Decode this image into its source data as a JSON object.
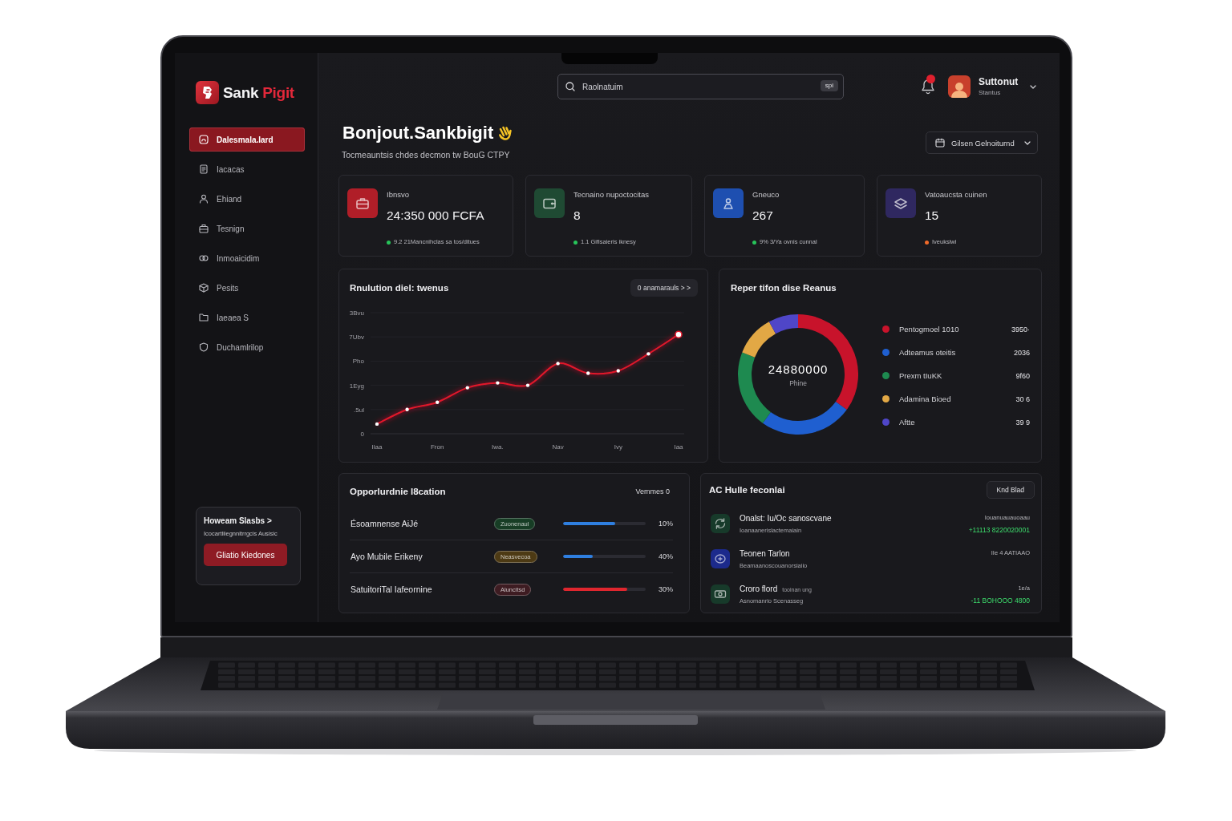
{
  "sidebar": {
    "logo": {
      "name": "Sank",
      "accent": "Pigit"
    },
    "nav": [
      {
        "label": "Dalesmala.Iard",
        "selected": true
      },
      {
        "label": "Iacacas",
        "selected": false
      },
      {
        "label": "Ehiand",
        "selected": false
      },
      {
        "label": "Tesnign",
        "selected": false
      },
      {
        "label": "Inmoaicidim",
        "selected": false
      },
      {
        "label": "Pesits",
        "selected": false
      },
      {
        "label": "Iaeaea S",
        "selected": false
      },
      {
        "label": "Duchamlrilop",
        "selected": false
      }
    ],
    "promo": {
      "title": "Howeam Slasbs >",
      "text": "Icocartliiegnnitrrgcis Ausisic",
      "button": "Gliatio Kiedones"
    }
  },
  "topbar": {
    "search": {
      "placeholder": "Raolnatuim",
      "shortcut": "spi"
    },
    "notifications": {
      "unread": true
    },
    "user": {
      "name": "Suttonut",
      "role": "Stantus"
    }
  },
  "header": {
    "title": "Bonjout.Sankbigit",
    "subtitle": "Tocmeauntsis chdes decmon tw BouG CTPY",
    "button": "Gilsen Gelnoiturnd"
  },
  "stats": [
    {
      "title": "Ibnsvo",
      "value": "24:350 000 FCFA",
      "color": "#b01e28",
      "trend": {
        "text": "9.2 21Mancnihclas sa tos/ditues",
        "color": "#27c45a"
      }
    },
    {
      "title": "Tecnaino nupoctocitas",
      "value": "8",
      "color": "#1f4a33",
      "trend": {
        "text": "1.1 Gifisaieris iknesy",
        "color": "#27c45a"
      }
    },
    {
      "title": "Gneuco",
      "value": "267",
      "color": "#1e4fb0",
      "trend": {
        "text": "9% 3/Ya ovnis cunnal",
        "color": "#27c45a"
      }
    },
    {
      "title": "Vatoaucsta cuinen",
      "value": "15",
      "color": "#2f2860",
      "trend": {
        "text": "Iveuksiwi",
        "color": "#f06a2a"
      }
    }
  ],
  "revenue_chart": {
    "title": "Rnulution diel: twenus",
    "period": "0 anamarauls > >",
    "y_axis_labels": [
      "3Bvu",
      "7Ubv",
      "Pho",
      "1Eyg",
      ".5ul",
      "0"
    ],
    "x_axis_labels": [
      "Ilaa",
      "Fron",
      "Iwa.",
      "Nav",
      "Ivy",
      "Iaa"
    ]
  },
  "breakdown": {
    "title": "Reper tifon dise Reanus",
    "total": "24880000",
    "total_label": "Phine",
    "legend": [
      {
        "label": "Pentogmoel 1010",
        "value": "3950·",
        "color": "#c8132b"
      },
      {
        "label": "Adteamus oteitis",
        "value": "2036",
        "color": "#1f5fd0"
      },
      {
        "label": "Prexm tIuKK",
        "value": "9f60",
        "color": "#1e8a50"
      },
      {
        "label": "Adamina Bioed",
        "value": "30 6",
        "color": "#e2a845"
      },
      {
        "label": "Aftte",
        "value": "39 9",
        "color": "#4f46c8"
      }
    ],
    "chart_data": {
      "type": "donut",
      "values": [
        35,
        25,
        21,
        11,
        8
      ]
    }
  },
  "opportunities": {
    "title": "Opporlurdnie l8cation",
    "filter": "Vemmes 0",
    "rows": [
      {
        "name": "Ésoamnense AiJé",
        "badge": {
          "text": "Zuonenaul",
          "color": "#173d25"
        },
        "progress": {
          "level": 0.63,
          "color": "#2f7fe0"
        },
        "percent": "10%"
      },
      {
        "name": "Ayo Mubile Erikeny",
        "badge": {
          "text": "Neasvecoa",
          "color": "#4d3a14"
        },
        "progress": {
          "level": 0.36,
          "color": "#2f7fe0"
        },
        "percent": "40%"
      },
      {
        "name": "SatuitoriTal Iafeornine",
        "badge": {
          "text": "Aluncitsd",
          "color": "#3e1c22"
        },
        "progress": {
          "level": 0.78,
          "color": "#e0262e"
        },
        "percent": "30%"
      }
    ]
  },
  "activity": {
    "title": "AC Hulle feconlai",
    "button": "Knd Blad",
    "rows": [
      {
        "title": "Onalst: Iu/Oc sanoscvane",
        "subtitle": "Ioanaanerislactemaiain",
        "date": "Iouanuauauoaau",
        "amount": "+11113 8220020001",
        "color": "#173a2a"
      },
      {
        "title": "Teonen Tarlon",
        "subtitle": "Beamaanoscouanorsiaiio",
        "date": "IIe 4 AATIAAO",
        "color": "#1c2a8c"
      },
      {
        "title": "Croro flord",
        "tag": "tooinan ung",
        "subtitle": "Asnomanrio Scenasseg",
        "date": "1e/a",
        "amount": "-11 BOHOOO 4800",
        "color": "#173a2a"
      }
    ]
  }
}
